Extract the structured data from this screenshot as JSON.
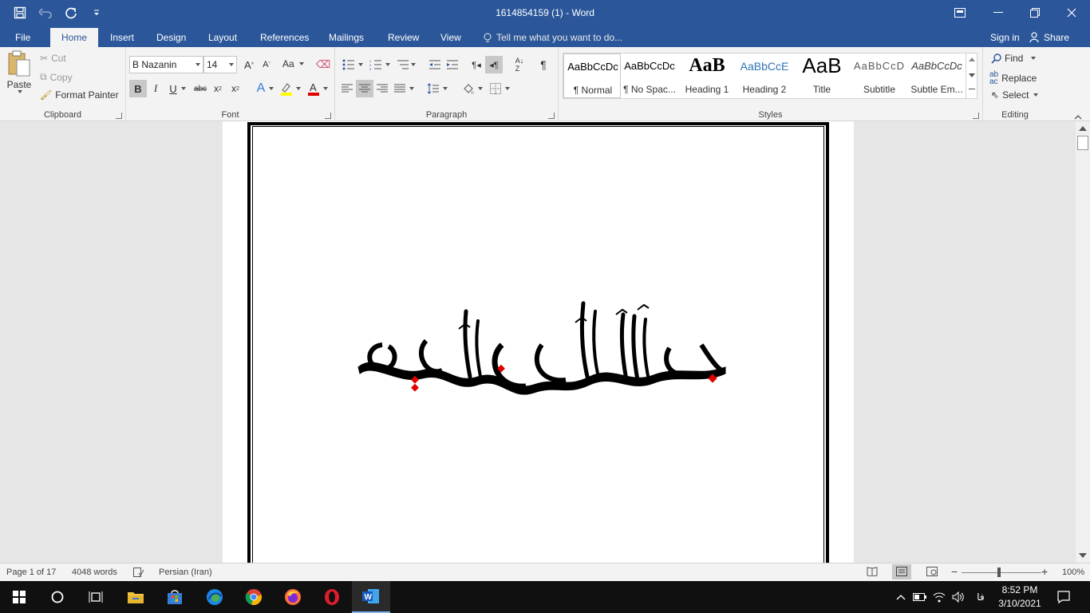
{
  "window": {
    "title": "1614854159 (1) - Word"
  },
  "tabs": {
    "file": "File",
    "home": "Home",
    "insert": "Insert",
    "design": "Design",
    "layout": "Layout",
    "references": "References",
    "mailings": "Mailings",
    "review": "Review",
    "view": "View",
    "tell_me": "Tell me what you want to do...",
    "sign_in": "Sign in",
    "share": "Share"
  },
  "clipboard": {
    "paste": "Paste",
    "cut": "Cut",
    "copy": "Copy",
    "format_painter": "Format Painter",
    "label": "Clipboard"
  },
  "font": {
    "name": "B Nazanin",
    "size": "14",
    "case_btn": "Aa",
    "label": "Font"
  },
  "paragraph": {
    "label": "Paragraph"
  },
  "styles": {
    "label": "Styles",
    "items": [
      {
        "preview": "AaBbCcDc",
        "name": "¶ Normal"
      },
      {
        "preview": "AaBbCcDc",
        "name": "¶ No Spac..."
      },
      {
        "preview": "AaB",
        "name": "Heading 1"
      },
      {
        "preview": "AaBbCcE",
        "name": "Heading 2"
      },
      {
        "preview": "AaB",
        "name": "Title"
      },
      {
        "preview": "AaBbCcD",
        "name": "Subtitle"
      },
      {
        "preview": "AaBbCcDc",
        "name": "Subtle Em..."
      }
    ]
  },
  "editing": {
    "find": "Find",
    "replace": "Replace",
    "select": "Select",
    "label": "Editing"
  },
  "status": {
    "page": "Page 1 of 17",
    "words": "4048 words",
    "language": "Persian (Iran)",
    "zoom": "100%"
  },
  "taskbar": {
    "time": "8:52 PM",
    "date": "3/10/2021",
    "input_lang": "فا"
  }
}
